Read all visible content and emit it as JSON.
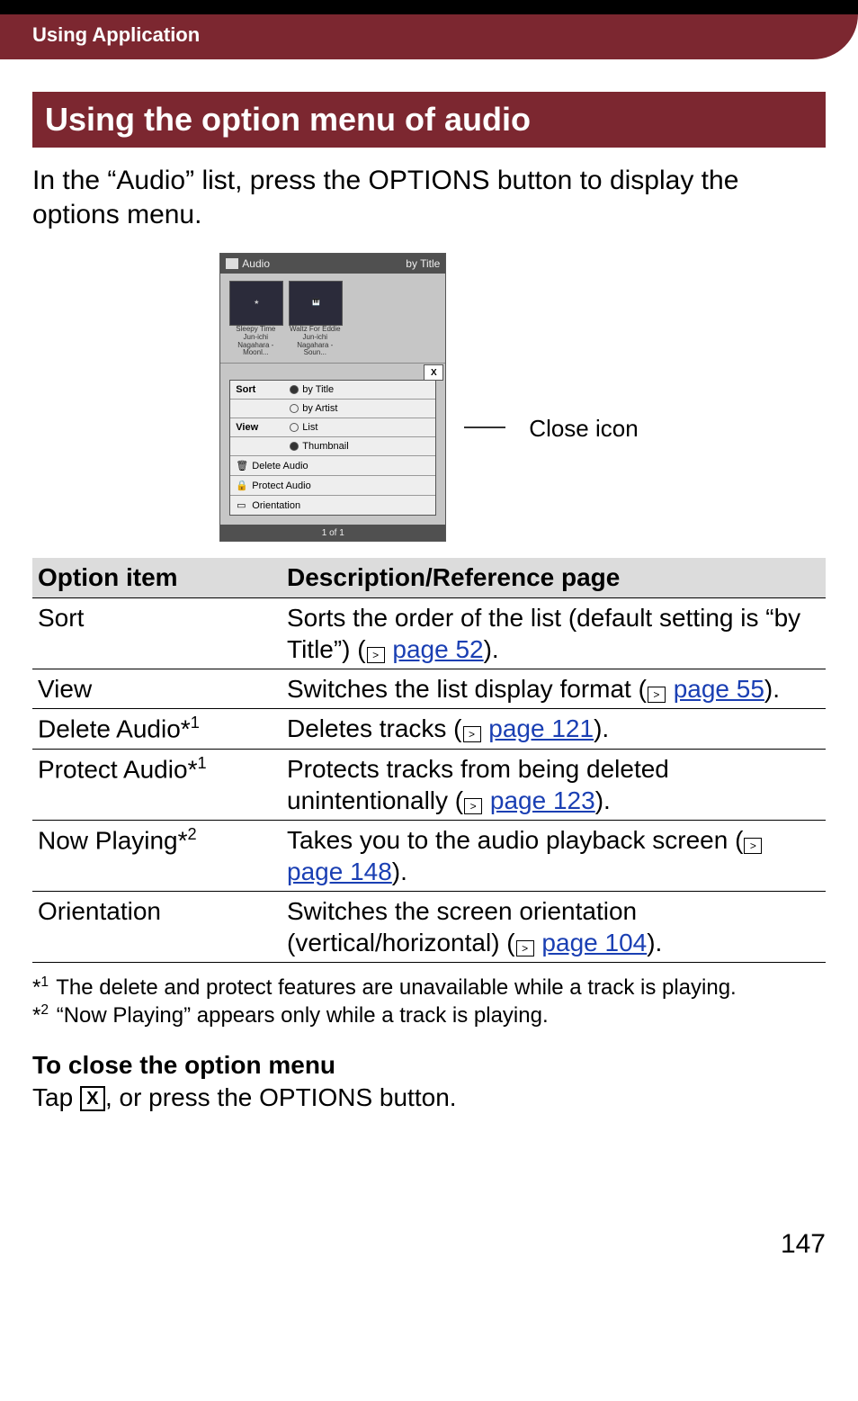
{
  "header": {
    "breadcrumb": "Using Application"
  },
  "section_title": "Using the option menu of audio",
  "intro": "In the “Audio” list, press the OPTIONS button to display the options menu.",
  "callout": {
    "close_icon_label": "Close icon"
  },
  "device": {
    "title": "Audio",
    "sort_hint": "by Title",
    "thumbs": [
      {
        "title": "Sleepy Time",
        "sub": "Jun-ichi Nagahara - Moonl..."
      },
      {
        "title": "Waltz For Eddie",
        "sub": "Jun-ichi Nagahara - Soun..."
      }
    ],
    "menu": {
      "sort_label": "Sort",
      "sort_by_title": "by Title",
      "sort_by_artist": "by Artist",
      "view_label": "View",
      "view_list": "List",
      "view_thumb": "Thumbnail",
      "delete_audio": "Delete Audio",
      "protect_audio": "Protect Audio",
      "orientation": "Orientation"
    },
    "footer": "1 of 1"
  },
  "table": {
    "head_col1": "Option item",
    "head_col2": "Description/Reference page",
    "rows": [
      {
        "item": "Sort",
        "desc_pre": "Sorts the order of the list (default setting is “by Title”) (",
        "link": "page 52",
        "desc_post": ")."
      },
      {
        "item": "View",
        "desc_pre": "Switches the list display format (",
        "link": "page 55",
        "desc_post": ")."
      },
      {
        "item": "Delete Audio",
        "sup": "1",
        "desc_pre": "Deletes tracks (",
        "link": "page 121",
        "desc_post": ")."
      },
      {
        "item": "Protect Audio",
        "sup": "1",
        "desc_pre": "Protects tracks from being deleted unintentionally (",
        "link": "page 123",
        "desc_post": ")."
      },
      {
        "item": "Now Playing",
        "sup": "2",
        "desc_pre": "Takes you to the audio playback screen (",
        "link": "page 148",
        "desc_post": ")."
      },
      {
        "item": "Orientation",
        "desc_pre": "Switches the screen orientation (vertical/horizontal) (",
        "link": "page 104",
        "desc_post": ")."
      }
    ]
  },
  "footnotes": {
    "f1": "The delete and protect features are unavailable while a track is playing.",
    "f2": "“Now Playing” appears only while a track is playing."
  },
  "close_section": {
    "heading": "To close the option menu",
    "body_pre": "Tap ",
    "body_post": ", or press the OPTIONS button."
  },
  "page_number": "147",
  "glyphs": {
    "ref_icon": ">",
    "x": "X"
  }
}
